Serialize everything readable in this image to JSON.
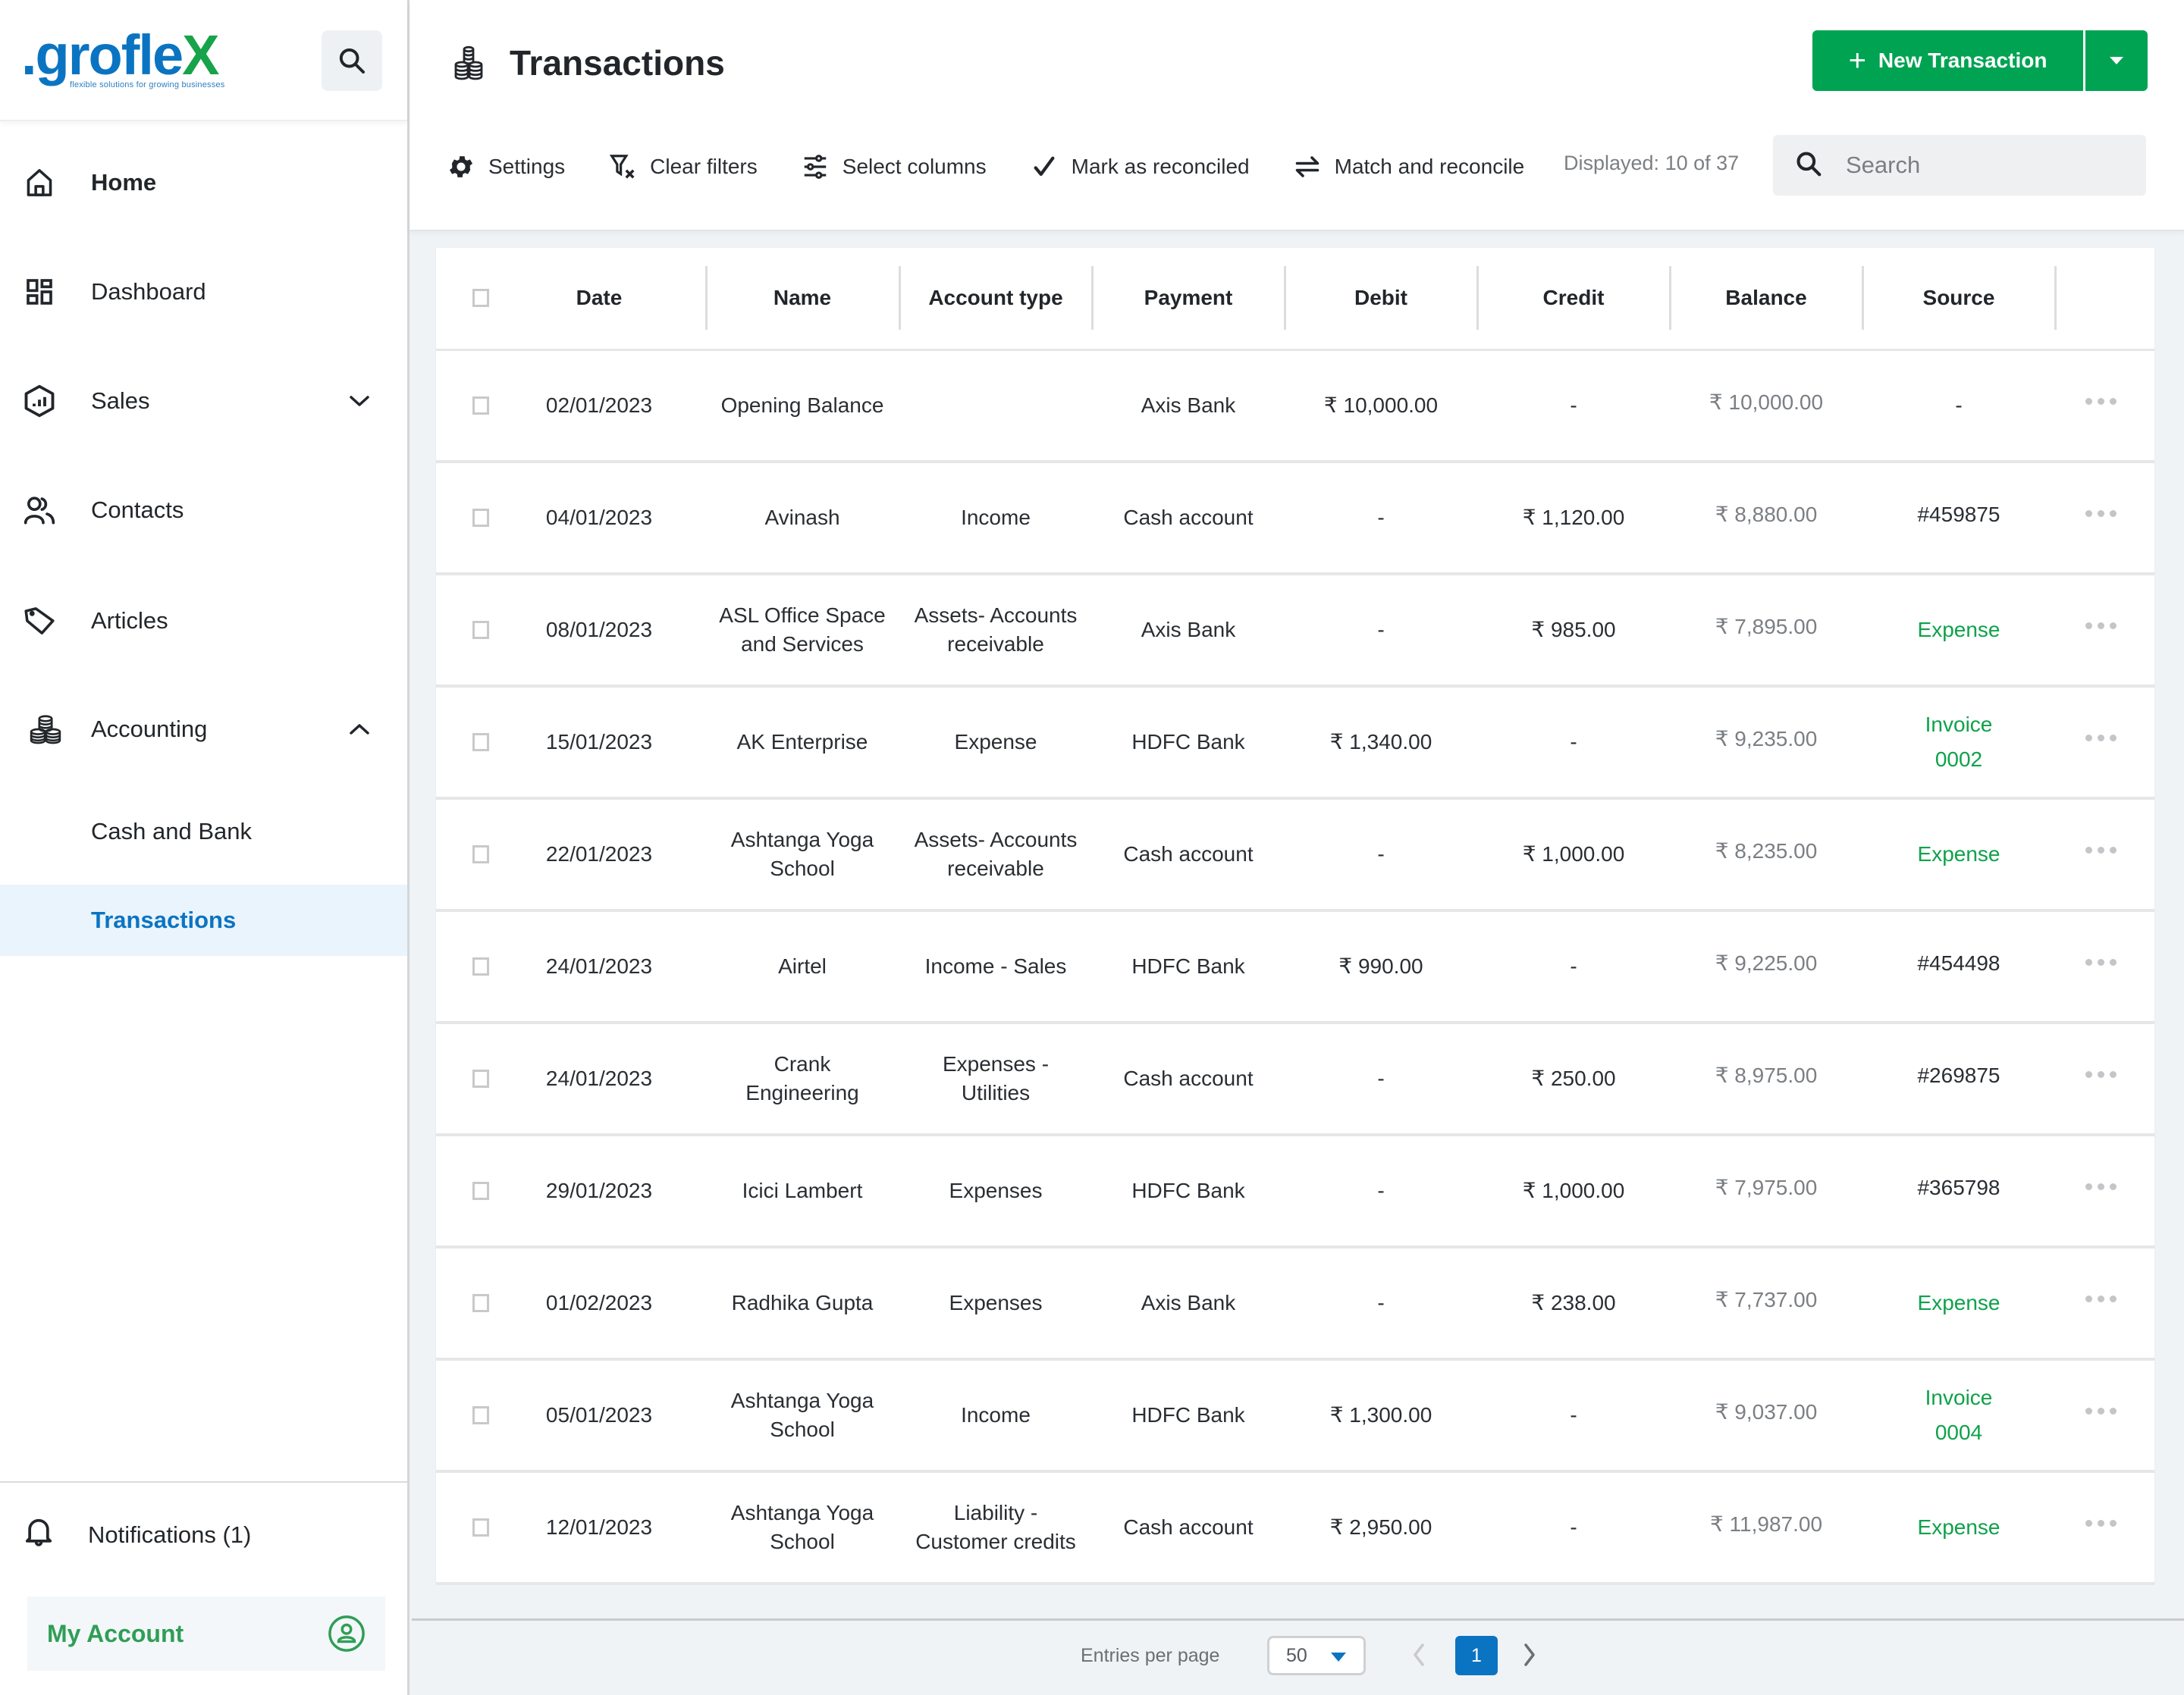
{
  "brand": {
    "logo_prefix": ".grofle",
    "logo_suffix": "X",
    "tagline": "flexible solutions for growing businesses",
    "brand_blue": "#0b74c2",
    "brand_green": "#16a34a"
  },
  "sidebar": {
    "search_icon": "search-icon",
    "items": [
      {
        "label": "Home",
        "icon": "home-icon"
      },
      {
        "label": "Dashboard",
        "icon": "dashboard-icon"
      },
      {
        "label": "Sales",
        "icon": "sales-chart-icon",
        "expanded": false
      },
      {
        "label": "Contacts",
        "icon": "contacts-icon"
      },
      {
        "label": "Articles",
        "icon": "tag-icon"
      },
      {
        "label": "Accounting",
        "icon": "coins-icon",
        "expanded": true
      }
    ],
    "sub_items": [
      {
        "label": "Cash and Bank",
        "active": false
      },
      {
        "label": "Transactions",
        "active": true
      }
    ],
    "notifications_label": "Notifications (1)",
    "my_account_label": "My Account"
  },
  "header": {
    "title": "Transactions",
    "new_button_label": "New Transaction",
    "toolbar": {
      "settings": "Settings",
      "clear_filters": "Clear filters",
      "select_columns": "Select columns",
      "mark_reconciled": "Mark as reconciled",
      "match_reconcile": "Match and reconcile"
    },
    "displayed_text": "Displayed: 10 of 37",
    "search_placeholder": "Search"
  },
  "table": {
    "columns": [
      "Date",
      "Name",
      "Account type",
      "Payment",
      "Debit",
      "Credit",
      "Balance",
      "Source"
    ],
    "rows": [
      {
        "date": "02/01/2023",
        "name": [
          "Opening Balance"
        ],
        "account_type": [
          ""
        ],
        "payment": "Axis Bank",
        "debit": "₹ 10,000.00",
        "credit": "-",
        "balance": "₹ 10,000.00",
        "source": [
          "-"
        ],
        "source_type": "plain"
      },
      {
        "date": "04/01/2023",
        "name": [
          "Avinash"
        ],
        "account_type": [
          "Income"
        ],
        "payment": "Cash account",
        "debit": "-",
        "credit": "₹ 1,120.00",
        "balance": "₹ 8,880.00",
        "source": [
          "#459875"
        ],
        "source_type": "id"
      },
      {
        "date": "08/01/2023",
        "name": [
          "ASL Office Space",
          "and Services"
        ],
        "account_type": [
          "Assets- Accounts",
          "receivable"
        ],
        "payment": "Axis Bank",
        "debit": "-",
        "credit": "₹ 985.00",
        "balance": "₹ 7,895.00",
        "source": [
          "Expense"
        ],
        "source_type": "link"
      },
      {
        "date": "15/01/2023",
        "name": [
          "AK Enterprise"
        ],
        "account_type": [
          "Expense"
        ],
        "payment": "HDFC Bank",
        "debit": "₹ 1,340.00",
        "credit": "-",
        "balance": "₹ 9,235.00",
        "source": [
          "Invoice",
          "0002"
        ],
        "source_type": "link"
      },
      {
        "date": "22/01/2023",
        "name": [
          "Ashtanga Yoga",
          "School"
        ],
        "account_type": [
          "Assets- Accounts",
          "receivable"
        ],
        "payment": "Cash account",
        "debit": "-",
        "credit": "₹ 1,000.00",
        "balance": "₹ 8,235.00",
        "source": [
          "Expense"
        ],
        "source_type": "link"
      },
      {
        "date": "24/01/2023",
        "name": [
          "Airtel"
        ],
        "account_type": [
          "Income - Sales"
        ],
        "payment": "HDFC Bank",
        "debit": "₹ 990.00",
        "credit": "-",
        "balance": "₹ 9,225.00",
        "source": [
          "#454498"
        ],
        "source_type": "id"
      },
      {
        "date": "24/01/2023",
        "name": [
          "Crank",
          "Engineering"
        ],
        "account_type": [
          "Expenses -",
          "Utilities"
        ],
        "payment": "Cash account",
        "debit": "-",
        "credit": "₹ 250.00",
        "balance": "₹ 8,975.00",
        "source": [
          "#269875"
        ],
        "source_type": "id"
      },
      {
        "date": "29/01/2023",
        "name": [
          "Icici Lambert"
        ],
        "account_type": [
          "Expenses"
        ],
        "payment": "HDFC Bank",
        "debit": "-",
        "credit": "₹ 1,000.00",
        "balance": "₹ 7,975.00",
        "source": [
          "#365798"
        ],
        "source_type": "id"
      },
      {
        "date": "01/02/2023",
        "name": [
          "Radhika Gupta"
        ],
        "account_type": [
          "Expenses"
        ],
        "payment": "Axis Bank",
        "debit": "-",
        "credit": "₹ 238.00",
        "balance": "₹ 7,737.00",
        "source": [
          "Expense"
        ],
        "source_type": "link"
      },
      {
        "date": "05/01/2023",
        "name": [
          "Ashtanga Yoga",
          "School"
        ],
        "account_type": [
          "Income"
        ],
        "payment": "HDFC Bank",
        "debit": "₹ 1,300.00",
        "credit": "-",
        "balance": "₹ 9,037.00",
        "source": [
          "Invoice",
          "0004"
        ],
        "source_type": "link"
      },
      {
        "date": "12/01/2023",
        "name": [
          "Ashtanga Yoga",
          "School"
        ],
        "account_type": [
          "Liability -",
          "Customer credits"
        ],
        "payment": "Cash account",
        "debit": "₹ 2,950.00",
        "credit": "-",
        "balance": "₹ 11,987.00",
        "source": [
          "Expense"
        ],
        "source_type": "link"
      }
    ]
  },
  "pagination": {
    "entries_label": "Entries per page",
    "entries_value": "50",
    "current_page": "1"
  },
  "colors": {
    "primary_green": "#00a352",
    "link_green": "#0ea24a",
    "active_blue": "#0b74c2"
  }
}
